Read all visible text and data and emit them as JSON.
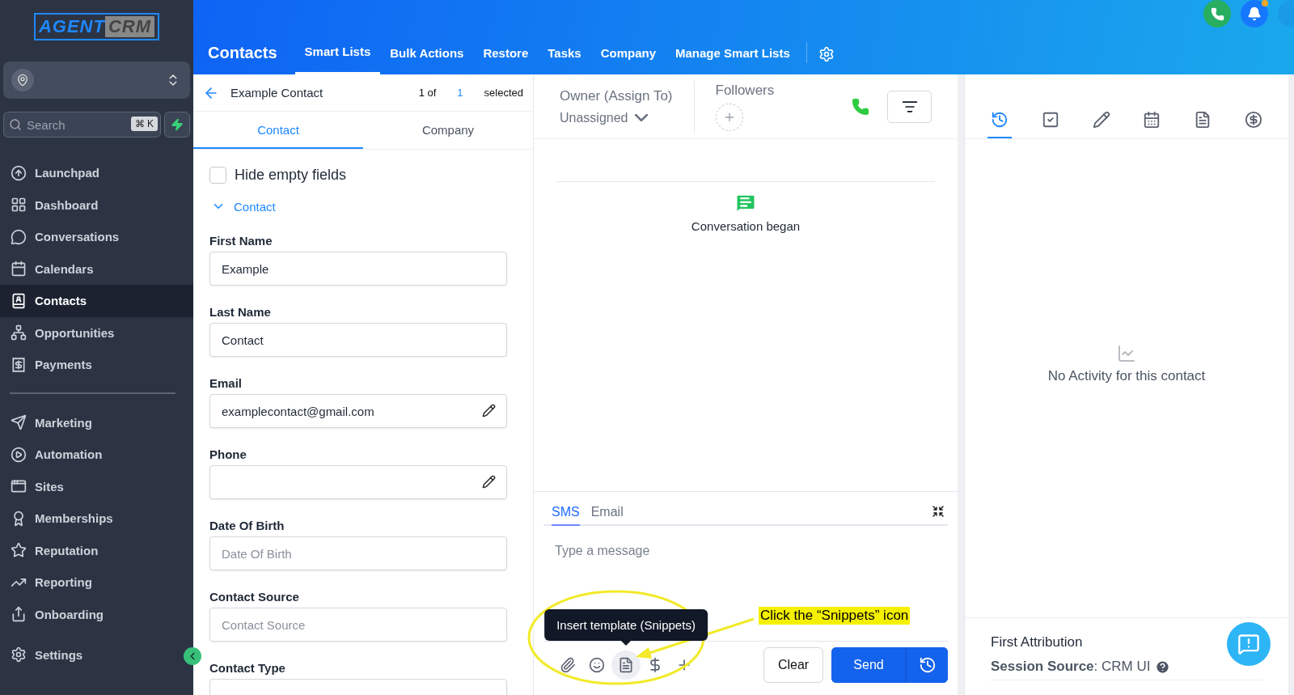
{
  "logo": {
    "text_1": "AGENT",
    "text_2": "CRM"
  },
  "sidebar": {
    "search": {
      "placeholder": "Search",
      "shortcut": "⌘ K"
    },
    "groups": [
      [
        {
          "label": "Launchpad",
          "selected": false
        },
        {
          "label": "Dashboard",
          "selected": false
        },
        {
          "label": "Conversations",
          "selected": false
        },
        {
          "label": "Calendars",
          "selected": false
        },
        {
          "label": "Contacts",
          "selected": true
        },
        {
          "label": "Opportunities",
          "selected": false
        },
        {
          "label": "Payments",
          "selected": false
        }
      ],
      [
        {
          "label": "Marketing",
          "selected": false
        },
        {
          "label": "Automation",
          "selected": false
        },
        {
          "label": "Sites",
          "selected": false
        },
        {
          "label": "Memberships",
          "selected": false
        },
        {
          "label": "Reputation",
          "selected": false
        },
        {
          "label": "Reporting",
          "selected": false
        },
        {
          "label": "Onboarding",
          "selected": false
        }
      ]
    ],
    "settings": {
      "label": "Settings",
      "selected": false
    }
  },
  "header": {
    "title": "Contacts",
    "tabs": [
      {
        "label": "Smart Lists",
        "selected": true
      },
      {
        "label": "Bulk Actions",
        "selected": false
      },
      {
        "label": "Restore",
        "selected": false
      },
      {
        "label": "Tasks",
        "selected": false
      },
      {
        "label": "Company",
        "selected": false
      },
      {
        "label": "Manage Smart Lists",
        "selected": false
      }
    ],
    "bell_unread": true
  },
  "contact": {
    "name": "Example Contact",
    "count_prefix": "1 of",
    "count": "1",
    "count_suffix": "selected",
    "tabs": [
      {
        "label": "Contact",
        "selected": true
      },
      {
        "label": "Company",
        "selected": false
      }
    ],
    "hide_empty": {
      "label": "Hide empty fields",
      "checked": false
    },
    "section": {
      "title": "Contact",
      "expanded": true
    },
    "fields": [
      {
        "label": "First Name",
        "value": "Example",
        "kind": "text"
      },
      {
        "label": "Last Name",
        "value": "Contact",
        "kind": "text"
      },
      {
        "label": "Email",
        "value": "examplecontact@gmail.com",
        "kind": "editable"
      },
      {
        "label": "Phone",
        "kind": "editable"
      },
      {
        "label": "Date Of Birth",
        "placeholder": "Date Of Birth",
        "kind": "text"
      },
      {
        "label": "Contact Source",
        "placeholder": "Contact Source",
        "kind": "text"
      },
      {
        "label": "Contact Type",
        "kind": "cut"
      }
    ]
  },
  "conversation": {
    "owner": {
      "label": "Owner (Assign To)",
      "value": "Unassigned"
    },
    "followers": {
      "label": "Followers"
    },
    "events": [
      {
        "text": "Conversation began"
      }
    ],
    "composer": {
      "tabs": [
        {
          "label": "SMS",
          "selected": true
        },
        {
          "label": "Email",
          "selected": false
        }
      ],
      "placeholder": "Type a message",
      "tools": [
        {
          "hovered": false
        },
        {
          "hovered": false
        },
        {
          "hovered": true
        },
        {
          "hovered": false
        },
        {
          "hovered": false
        }
      ],
      "tooltip": "Insert template (Snippets)",
      "clear": "Clear",
      "send": "Send"
    }
  },
  "activity": {
    "tabs": [
      {
        "selected": true
      },
      {
        "selected": false
      },
      {
        "selected": false
      },
      {
        "selected": false
      },
      {
        "selected": false
      },
      {
        "selected": false
      }
    ],
    "empty": "No Activity for this contact",
    "attribution": {
      "title": "First Attribution",
      "source": "**Session Source**: CRM UI"
    }
  },
  "annotation": {
    "text": "Click the “Snippets” icon"
  }
}
